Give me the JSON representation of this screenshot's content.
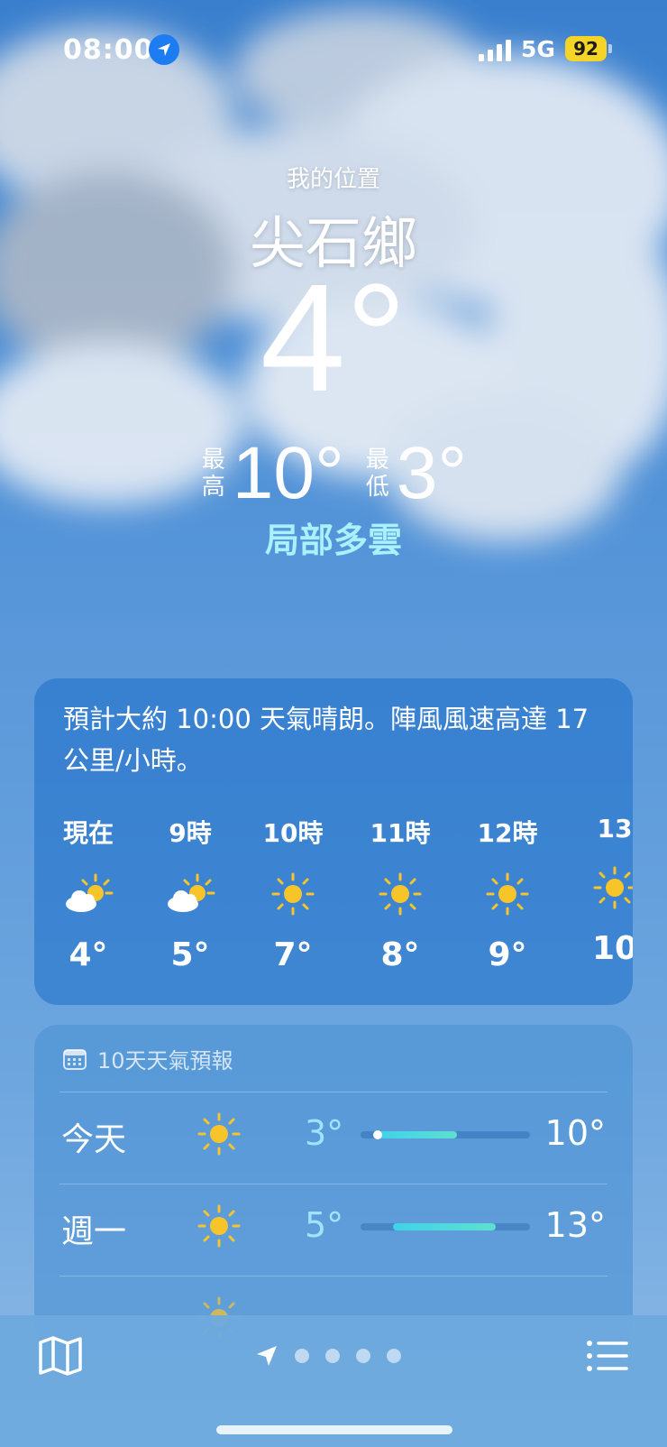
{
  "status_bar": {
    "time": "08:00",
    "network": "5G",
    "battery": "92"
  },
  "location": {
    "label": "我的位置",
    "city": "尖石鄉"
  },
  "current": {
    "temp": "4°",
    "high_label": "最高",
    "high": "10°",
    "low_label": "最低",
    "low": "3°",
    "condition": "局部多雲"
  },
  "hourly": {
    "summary": "預計大約 10:00 天氣晴朗。陣風風速高達 17 公里/小時。",
    "hours": [
      {
        "label": "現在",
        "icon": "partly-sunny-icon",
        "temp": "4°"
      },
      {
        "label": "9時",
        "icon": "partly-sunny-icon",
        "temp": "5°"
      },
      {
        "label": "10時",
        "icon": "sun-icon",
        "temp": "7°"
      },
      {
        "label": "11時",
        "icon": "sun-icon",
        "temp": "8°"
      },
      {
        "label": "12時",
        "icon": "sun-icon",
        "temp": "9°"
      },
      {
        "label": "13",
        "icon": "sun-icon",
        "temp": "10"
      }
    ]
  },
  "daily": {
    "title": "10天天氣預報",
    "days": [
      {
        "name": "今天",
        "icon": "sun-icon",
        "low": "3°",
        "high": "10°",
        "range_start": 0.1,
        "range_end": 0.57,
        "current_marker": 0.1
      },
      {
        "name": "週一",
        "icon": "sun-icon",
        "low": "5°",
        "high": "13°",
        "range_start": 0.19,
        "range_end": 0.8
      }
    ]
  },
  "tabbar": {
    "icons": [
      "map-icon",
      "location-arrow-icon",
      "list-icon"
    ],
    "page_dots": 4
  },
  "colors": {
    "condition": "#a9f1ff",
    "low_temp": "#9fe3ff",
    "battery": "#f5d327",
    "location_badge": "#1d7cf2"
  }
}
